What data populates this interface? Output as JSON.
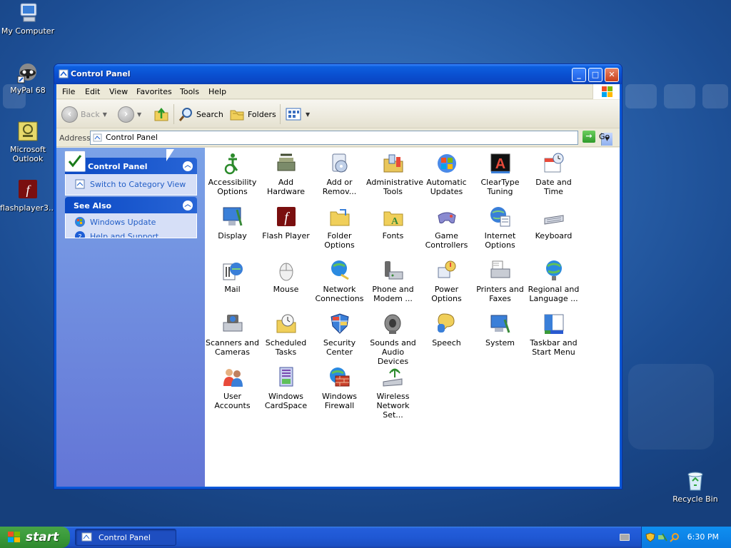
{
  "desktop": {
    "icons": [
      {
        "label": "My Computer",
        "icon": "my-computer-icon"
      },
      {
        "label": "MyPal 68",
        "icon": "mypal-raccoon-icon"
      },
      {
        "label": "Microsoft Outlook",
        "icon": "outlook-icon"
      },
      {
        "label": "flashplayer3...",
        "icon": "flash-player-icon"
      },
      {
        "label": "Recycle Bin",
        "icon": "recycle-bin-icon"
      }
    ],
    "background_color": "#2b63ad"
  },
  "window": {
    "title": "Control Panel",
    "controls": {
      "minimize": "_",
      "maximize": "□",
      "close": "✕"
    },
    "menu": [
      "File",
      "Edit",
      "View",
      "Favorites",
      "Tools",
      "Help"
    ],
    "toolbar": {
      "back": "Back",
      "search": "Search",
      "folders": "Folders"
    },
    "address": {
      "label": "Address",
      "value": "Control Panel",
      "go": "Go"
    },
    "task_pane": {
      "control_panel": {
        "title": "Control Panel",
        "links": [
          "Switch to Category View"
        ]
      },
      "see_also": {
        "title": "See Also",
        "links": [
          "Windows Update",
          "Help and Support"
        ]
      }
    },
    "items": [
      {
        "label": "Accessibility Options",
        "icon": "accessibility-icon"
      },
      {
        "label": "Add Hardware",
        "icon": "add-hardware-icon"
      },
      {
        "label": "Add or Remov...",
        "icon": "add-remove-programs-icon"
      },
      {
        "label": "Administrative Tools",
        "icon": "administrative-tools-icon"
      },
      {
        "label": "Automatic Updates",
        "icon": "automatic-updates-icon"
      },
      {
        "label": "ClearType Tuning",
        "icon": "cleartype-icon"
      },
      {
        "label": "Date and Time",
        "icon": "date-time-icon"
      },
      {
        "label": "Display",
        "icon": "display-icon"
      },
      {
        "label": "Flash Player",
        "icon": "flash-player-icon"
      },
      {
        "label": "Folder Options",
        "icon": "folder-options-icon"
      },
      {
        "label": "Fonts",
        "icon": "fonts-icon"
      },
      {
        "label": "Game Controllers",
        "icon": "game-controllers-icon"
      },
      {
        "label": "Internet Options",
        "icon": "internet-options-icon"
      },
      {
        "label": "Keyboard",
        "icon": "keyboard-icon"
      },
      {
        "label": "Mail",
        "icon": "mail-icon"
      },
      {
        "label": "Mouse",
        "icon": "mouse-icon"
      },
      {
        "label": "Network Connections",
        "icon": "network-connections-icon"
      },
      {
        "label": "Phone and Modem ...",
        "icon": "phone-modem-icon"
      },
      {
        "label": "Power Options",
        "icon": "power-options-icon"
      },
      {
        "label": "Printers and Faxes",
        "icon": "printers-faxes-icon"
      },
      {
        "label": "Regional and Language ...",
        "icon": "regional-language-icon"
      },
      {
        "label": "Scanners and Cameras",
        "icon": "scanners-cameras-icon"
      },
      {
        "label": "Scheduled Tasks",
        "icon": "scheduled-tasks-icon"
      },
      {
        "label": "Security Center",
        "icon": "security-center-icon"
      },
      {
        "label": "Sounds and Audio Devices",
        "icon": "sounds-audio-icon"
      },
      {
        "label": "Speech",
        "icon": "speech-icon"
      },
      {
        "label": "System",
        "icon": "system-icon"
      },
      {
        "label": "Taskbar and Start Menu",
        "icon": "taskbar-start-menu-icon"
      },
      {
        "label": "User Accounts",
        "icon": "user-accounts-icon"
      },
      {
        "label": "Windows CardSpace",
        "icon": "cardspace-icon"
      },
      {
        "label": "Windows Firewall",
        "icon": "firewall-icon"
      },
      {
        "label": "Wireless Network Set...",
        "icon": "wireless-network-icon"
      }
    ]
  },
  "taskbar": {
    "start": "start",
    "task": "Control Panel",
    "clock": "6:30 PM",
    "tray_icons": [
      "keyboard-icon",
      "security-shield-icon",
      "network-icon",
      "search-icon"
    ]
  },
  "colors": {
    "titlebar": "#0a4fd0",
    "start": "#3a9a3a",
    "taskpane": "#7ba2e7",
    "link": "#215dc6"
  }
}
